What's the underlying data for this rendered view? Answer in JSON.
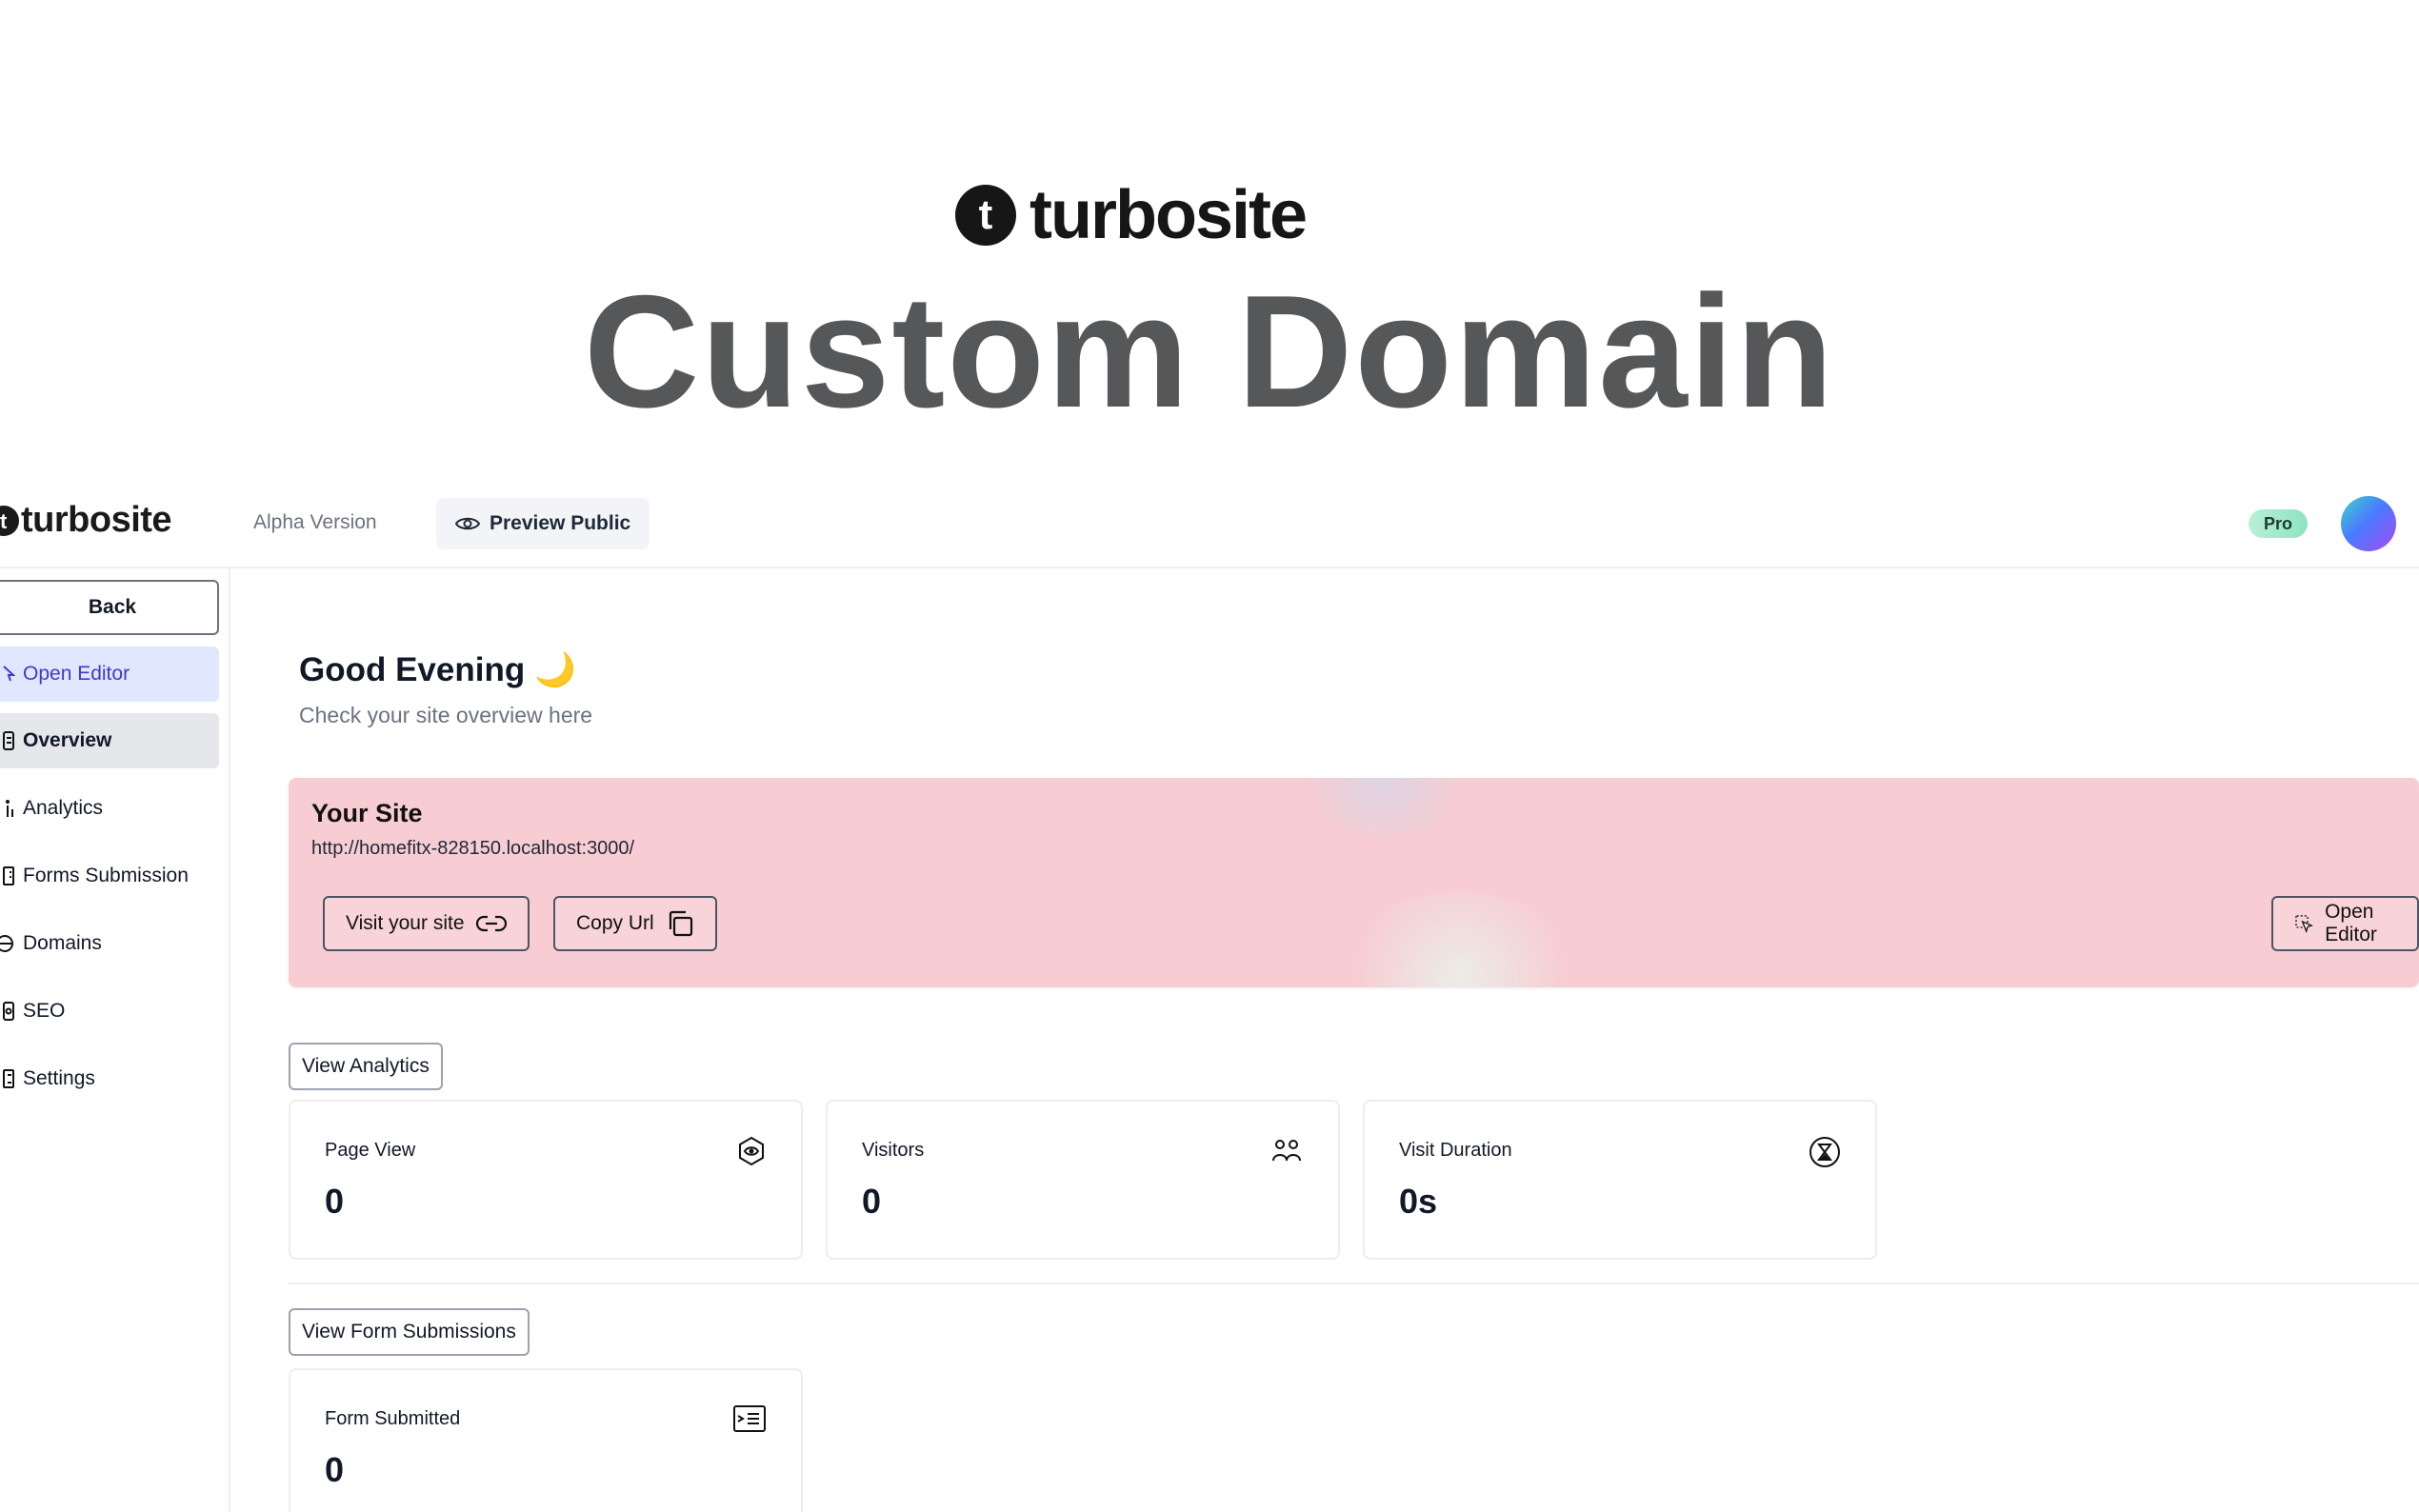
{
  "hero": {
    "logo_letter": "t",
    "logo_text": "turbosite",
    "title": "Custom Domain"
  },
  "topbar": {
    "brand": "turbosite",
    "version": "Alpha Version",
    "preview_label": "Preview Public",
    "badge": "Pro"
  },
  "sidebar": {
    "back_label": "Back",
    "items": [
      {
        "label": "Open Editor",
        "icon": "cursor-icon"
      },
      {
        "label": "Overview",
        "icon": "document-icon"
      },
      {
        "label": "Analytics",
        "icon": "chart-icon"
      },
      {
        "label": "Forms Submission",
        "icon": "form-icon"
      },
      {
        "label": "Domains",
        "icon": "globe-icon"
      },
      {
        "label": "SEO",
        "icon": "seo-icon"
      },
      {
        "label": "Settings",
        "icon": "settings-icon"
      }
    ]
  },
  "main": {
    "greeting": "Good Evening 🌙",
    "subtitle": "Check your site overview here",
    "site": {
      "title": "Your Site",
      "url": "http://homefitx-828150.localhost:3000/",
      "visit_label": "Visit your site",
      "copy_label": "Copy Url",
      "editor_label": "Open Editor"
    },
    "analytics_button": "View Analytics",
    "stats": [
      {
        "label": "Page View",
        "value": "0"
      },
      {
        "label": "Visitors",
        "value": "0"
      },
      {
        "label": "Visit Duration",
        "value": "0s"
      }
    ],
    "forms_button": "View Form Submissions",
    "form_stat": {
      "label": "Form Submitted",
      "value": "0"
    }
  },
  "colors": {
    "site_card_bg": "#f7cdd3",
    "editor_highlight": "#e0e7ff",
    "editor_text": "#4338ca",
    "hero_title": "#555759"
  }
}
